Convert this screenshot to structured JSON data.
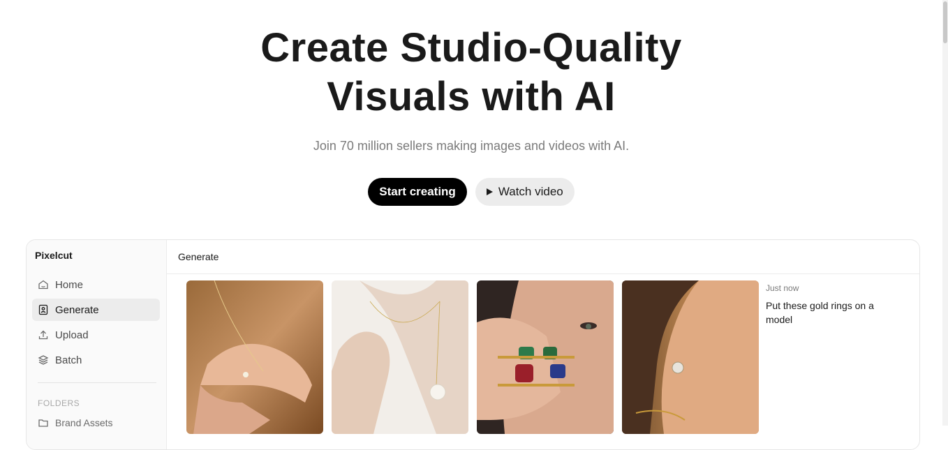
{
  "hero": {
    "title_line1": "Create Studio-Quality",
    "title_line2": "Visuals with AI",
    "subtitle": "Join 70 million sellers making images and videos with AI.",
    "primary_cta": "Start creating",
    "secondary_cta": "Watch video"
  },
  "app": {
    "brand": "Pixelcut",
    "nav": [
      {
        "label": "Home",
        "icon": "home-icon"
      },
      {
        "label": "Generate",
        "icon": "generate-icon",
        "active": true
      },
      {
        "label": "Upload",
        "icon": "upload-icon"
      },
      {
        "label": "Batch",
        "icon": "layers-icon"
      }
    ],
    "folders_label": "FOLDERS",
    "folders": [
      {
        "label": "Brand Assets",
        "icon": "folder-icon"
      }
    ],
    "main_title": "Generate",
    "generation": {
      "time": "Just now",
      "prompt": "Put these gold rings on a model"
    }
  },
  "colors": {
    "primary_button": "#000000",
    "secondary_button": "#ececec",
    "active_nav": "#ececec"
  }
}
